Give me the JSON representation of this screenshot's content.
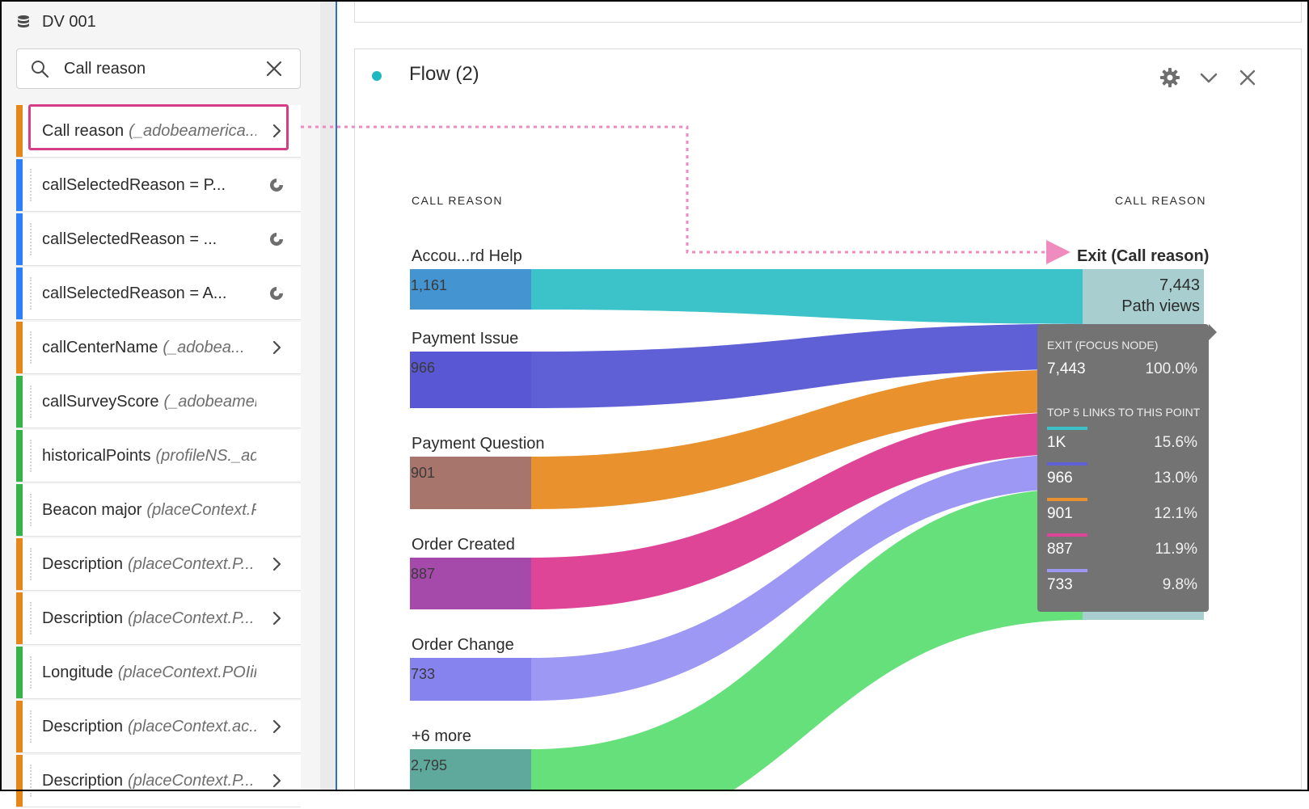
{
  "rail": {
    "datasource": "DV 001",
    "search": {
      "value": "Call reason",
      "placeholder": ""
    },
    "items": [
      {
        "label": "Call reason",
        "hint": "(_adobeamerica...",
        "color": "#e68619",
        "trail": "chevron"
      },
      {
        "label": "callSelectedReason = P...",
        "hint": "",
        "color": "#2d7ff9",
        "trail": "segment"
      },
      {
        "label": "callSelectedReason = ...",
        "hint": "",
        "color": "#2d7ff9",
        "trail": "segment"
      },
      {
        "label": "callSelectedReason = A...",
        "hint": "",
        "color": "#2d7ff9",
        "trail": "segment"
      },
      {
        "label": "callCenterName",
        "hint": "(_adobea...",
        "color": "#e68619",
        "trail": "chevron"
      },
      {
        "label": "callSurveyScore",
        "hint": "(_adobeameric...",
        "color": "#35b24a",
        "trail": "none"
      },
      {
        "label": "historicalPoints",
        "hint": "(profileNS._adob...",
        "color": "#35b24a",
        "trail": "none"
      },
      {
        "label": "Beacon major",
        "hint": "(placeContext.POI...",
        "color": "#35b24a",
        "trail": "none"
      },
      {
        "label": "Description",
        "hint": "(placeContext.P...",
        "color": "#e68619",
        "trail": "chevron"
      },
      {
        "label": "Description",
        "hint": "(placeContext.P...",
        "color": "#e68619",
        "trail": "chevron"
      },
      {
        "label": "Longitude",
        "hint": "(placeContext.POIinte...",
        "color": "#35b24a",
        "trail": "none"
      },
      {
        "label": "Description",
        "hint": "(placeContext.ac...",
        "color": "#e68619",
        "trail": "chevron"
      },
      {
        "label": "Description",
        "hint": "(placeContext.P...",
        "color": "#e68619",
        "trail": "chevron"
      }
    ]
  },
  "panel": {
    "title": "Flow (2)",
    "status_color": "#1fb7c0",
    "icons": [
      "gear-icon",
      "chevron-down-icon",
      "close-icon"
    ]
  },
  "flow": {
    "left_header": "CALL REASON",
    "right_header": "CALL REASON",
    "nodes": [
      {
        "label": "Accou...rd Help",
        "value": "1,161",
        "count": 1161,
        "node_color": "#4394d0",
        "link_color": "#3bc3c9"
      },
      {
        "label": "Payment Issue",
        "value": "966",
        "count": 966,
        "node_color": "#5a57d4",
        "link_color": "#5f5fd6"
      },
      {
        "label": "Payment Question",
        "value": "901",
        "count": 901,
        "node_color": "#a8756c",
        "link_color": "#e8912d"
      },
      {
        "label": "Order Created",
        "value": "887",
        "count": 887,
        "node_color": "#a54aab",
        "link_color": "#df4596"
      },
      {
        "label": "Order Change",
        "value": "733",
        "count": 733,
        "node_color": "#8682ee",
        "link_color": "#9c98f3"
      },
      {
        "label": "+6 more",
        "value": "2,795",
        "count": 2795,
        "node_color": "#5fa99c",
        "link_color": "#66e07b"
      }
    ],
    "exit": {
      "label": "Exit (Call reason)",
      "value": "7,443",
      "sub": "Path views",
      "color": "#9fc9cb"
    }
  },
  "tooltip": {
    "focus_header": "EXIT (FOCUS NODE)",
    "focus_value": "7,443",
    "focus_pct": "100.0%",
    "links_header": "TOP 5 LINKS TO THIS POINT",
    "links": [
      {
        "value": "1K",
        "pct": "15.6%",
        "color": "#3bc3c9"
      },
      {
        "value": "966",
        "pct": "13.0%",
        "color": "#5f5fd6"
      },
      {
        "value": "901",
        "pct": "12.1%",
        "color": "#e8912d"
      },
      {
        "value": "887",
        "pct": "11.9%",
        "color": "#df4596"
      },
      {
        "value": "733",
        "pct": "9.8%",
        "color": "#9c98f3"
      }
    ]
  }
}
